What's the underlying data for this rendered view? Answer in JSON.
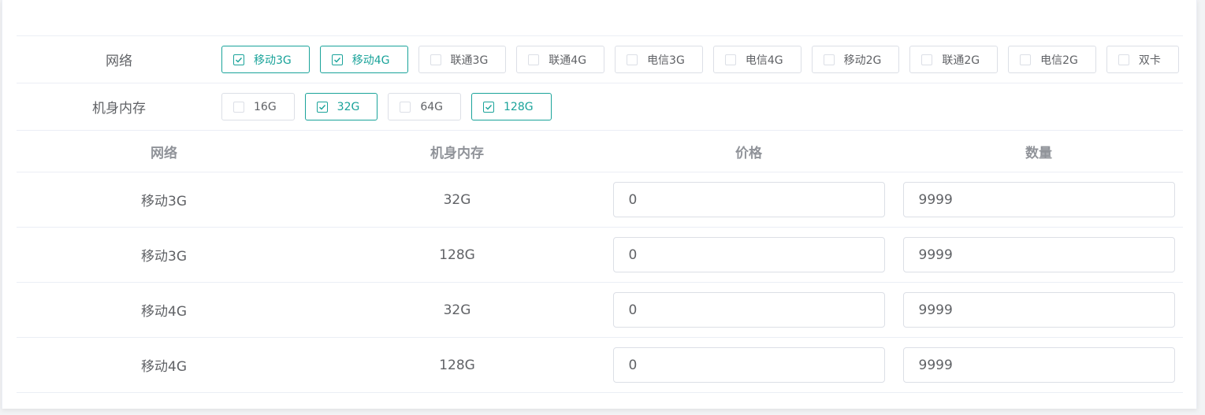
{
  "spec_groups": [
    {
      "label": "网络",
      "options": [
        {
          "label": "移动3G",
          "checked": true
        },
        {
          "label": "移动4G",
          "checked": true
        },
        {
          "label": "联通3G",
          "checked": false
        },
        {
          "label": "联通4G",
          "checked": false
        },
        {
          "label": "电信3G",
          "checked": false
        },
        {
          "label": "电信4G",
          "checked": false
        },
        {
          "label": "移动2G",
          "checked": false
        },
        {
          "label": "联通2G",
          "checked": false
        },
        {
          "label": "电信2G",
          "checked": false
        },
        {
          "label": "双卡",
          "checked": false
        }
      ]
    },
    {
      "label": "机身内存",
      "options": [
        {
          "label": "16G",
          "checked": false
        },
        {
          "label": "32G",
          "checked": true
        },
        {
          "label": "64G",
          "checked": false
        },
        {
          "label": "128G",
          "checked": true
        }
      ]
    }
  ],
  "table": {
    "headers": [
      "网络",
      "机身内存",
      "价格",
      "数量"
    ],
    "rows": [
      {
        "network": "移动3G",
        "memory": "32G",
        "price": "0",
        "quantity": "9999"
      },
      {
        "network": "移动3G",
        "memory": "128G",
        "price": "0",
        "quantity": "9999"
      },
      {
        "network": "移动4G",
        "memory": "32G",
        "price": "0",
        "quantity": "9999"
      },
      {
        "network": "移动4G",
        "memory": "128G",
        "price": "0",
        "quantity": "9999"
      }
    ]
  },
  "colors": {
    "accent": "#1aa39a",
    "border": "#dcdfe6",
    "divider": "#ebeef5",
    "text": "#606266",
    "header_text": "#909399"
  },
  "icons": {
    "checked": "check-icon"
  }
}
